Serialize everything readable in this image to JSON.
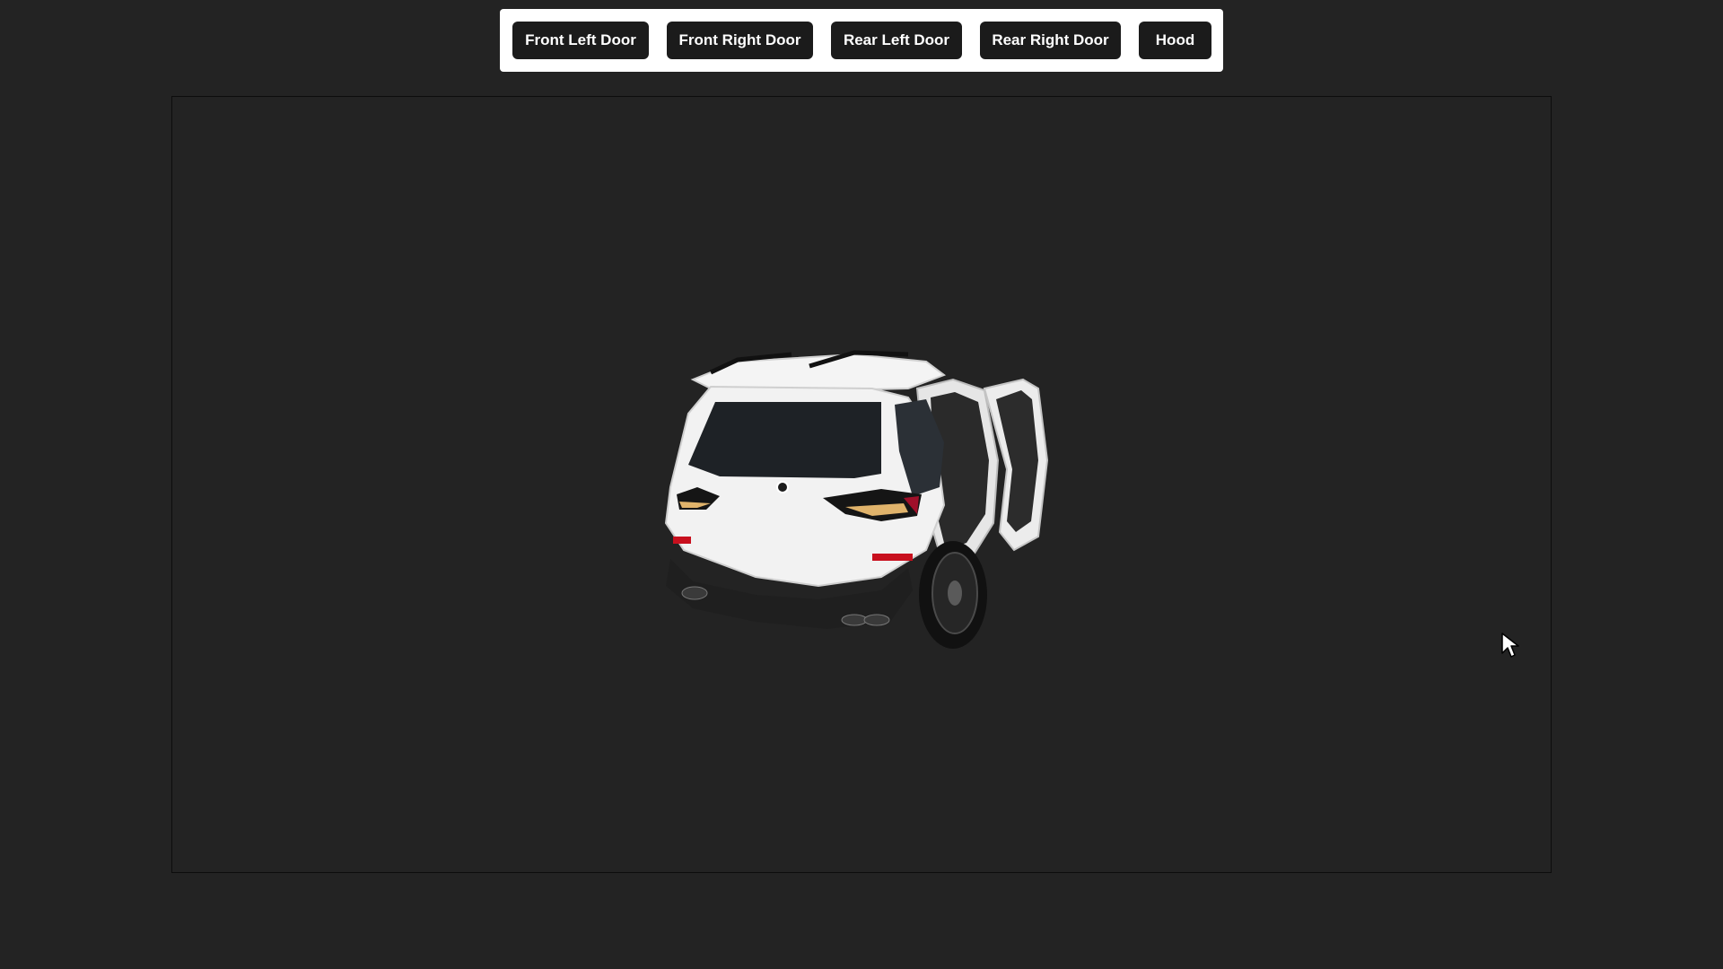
{
  "toolbar": {
    "buttons": [
      {
        "label": "Front Left Door"
      },
      {
        "label": "Front Right Door"
      },
      {
        "label": "Rear Left Door"
      },
      {
        "label": "Rear Right Door"
      },
      {
        "label": "Hood"
      }
    ]
  },
  "viewer": {
    "model": "car-model",
    "background": "#232323"
  },
  "colors": {
    "page_background": "#232323",
    "toolbar_background": "#ffffff",
    "button_background": "#1b1b1b",
    "button_text": "#ffffff",
    "car_body": "#f2f2f2"
  },
  "icons": {
    "cursor": "mouse-pointer-icon"
  }
}
